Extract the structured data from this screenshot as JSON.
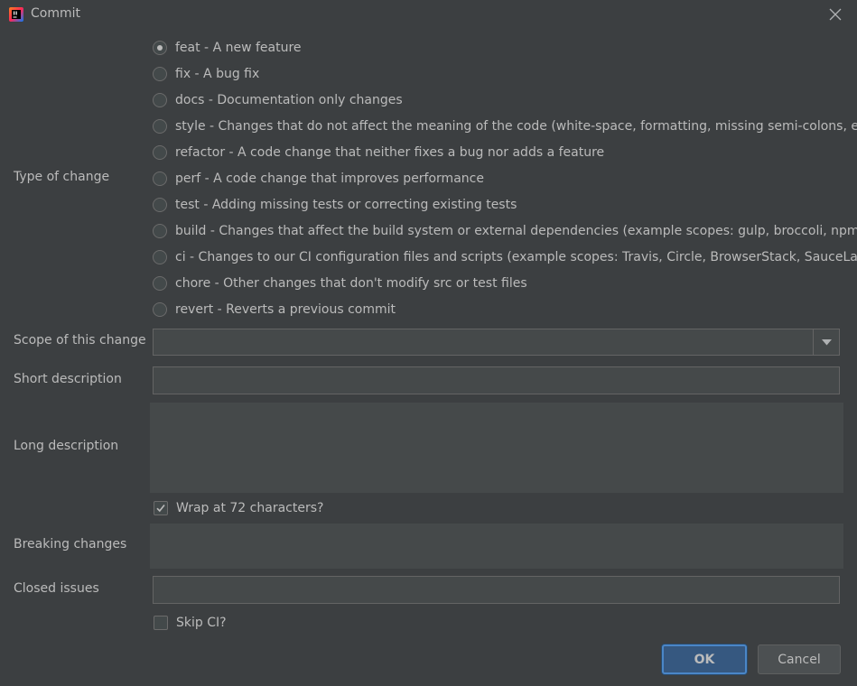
{
  "window": {
    "title": "Commit",
    "icon": "intellij-idea-icon",
    "close_icon": "close-icon"
  },
  "form": {
    "type_label": "Type of change",
    "types": [
      {
        "label": "feat - A new feature",
        "checked": true
      },
      {
        "label": "fix - A bug fix",
        "checked": false
      },
      {
        "label": "docs - Documentation only changes",
        "checked": false
      },
      {
        "label": "style - Changes that do not affect the meaning of the code (white-space, formatting, missing semi-colons, etc)",
        "checked": false
      },
      {
        "label": "refactor - A code change that neither fixes a bug nor adds a feature",
        "checked": false
      },
      {
        "label": "perf - A code change that improves performance",
        "checked": false
      },
      {
        "label": "test - Adding missing tests or correcting existing tests",
        "checked": false
      },
      {
        "label": "build - Changes that affect the build system or external dependencies (example scopes: gulp, broccoli, npm)",
        "checked": false
      },
      {
        "label": "ci - Changes to our CI configuration files and scripts (example scopes: Travis, Circle, BrowserStack, SauceLabs)",
        "checked": false
      },
      {
        "label": "chore - Other changes that don't modify src or test files",
        "checked": false
      },
      {
        "label": "revert - Reverts a previous commit",
        "checked": false
      }
    ],
    "scope_label": "Scope of this change",
    "scope_value": "",
    "short_label": "Short description",
    "short_value": "",
    "long_label": "Long description",
    "long_value": "",
    "wrap_label": "Wrap at 72 characters?",
    "wrap_checked": true,
    "breaking_label": "Breaking changes",
    "breaking_value": "",
    "closed_label": "Closed issues",
    "closed_value": "",
    "skip_ci_label": "Skip CI?",
    "skip_ci_checked": false
  },
  "buttons": {
    "ok": "OK",
    "cancel": "Cancel"
  },
  "colors": {
    "background": "#3c3f41",
    "field": "#45494a",
    "accent": "#365880",
    "text": "#bbbbbb"
  }
}
